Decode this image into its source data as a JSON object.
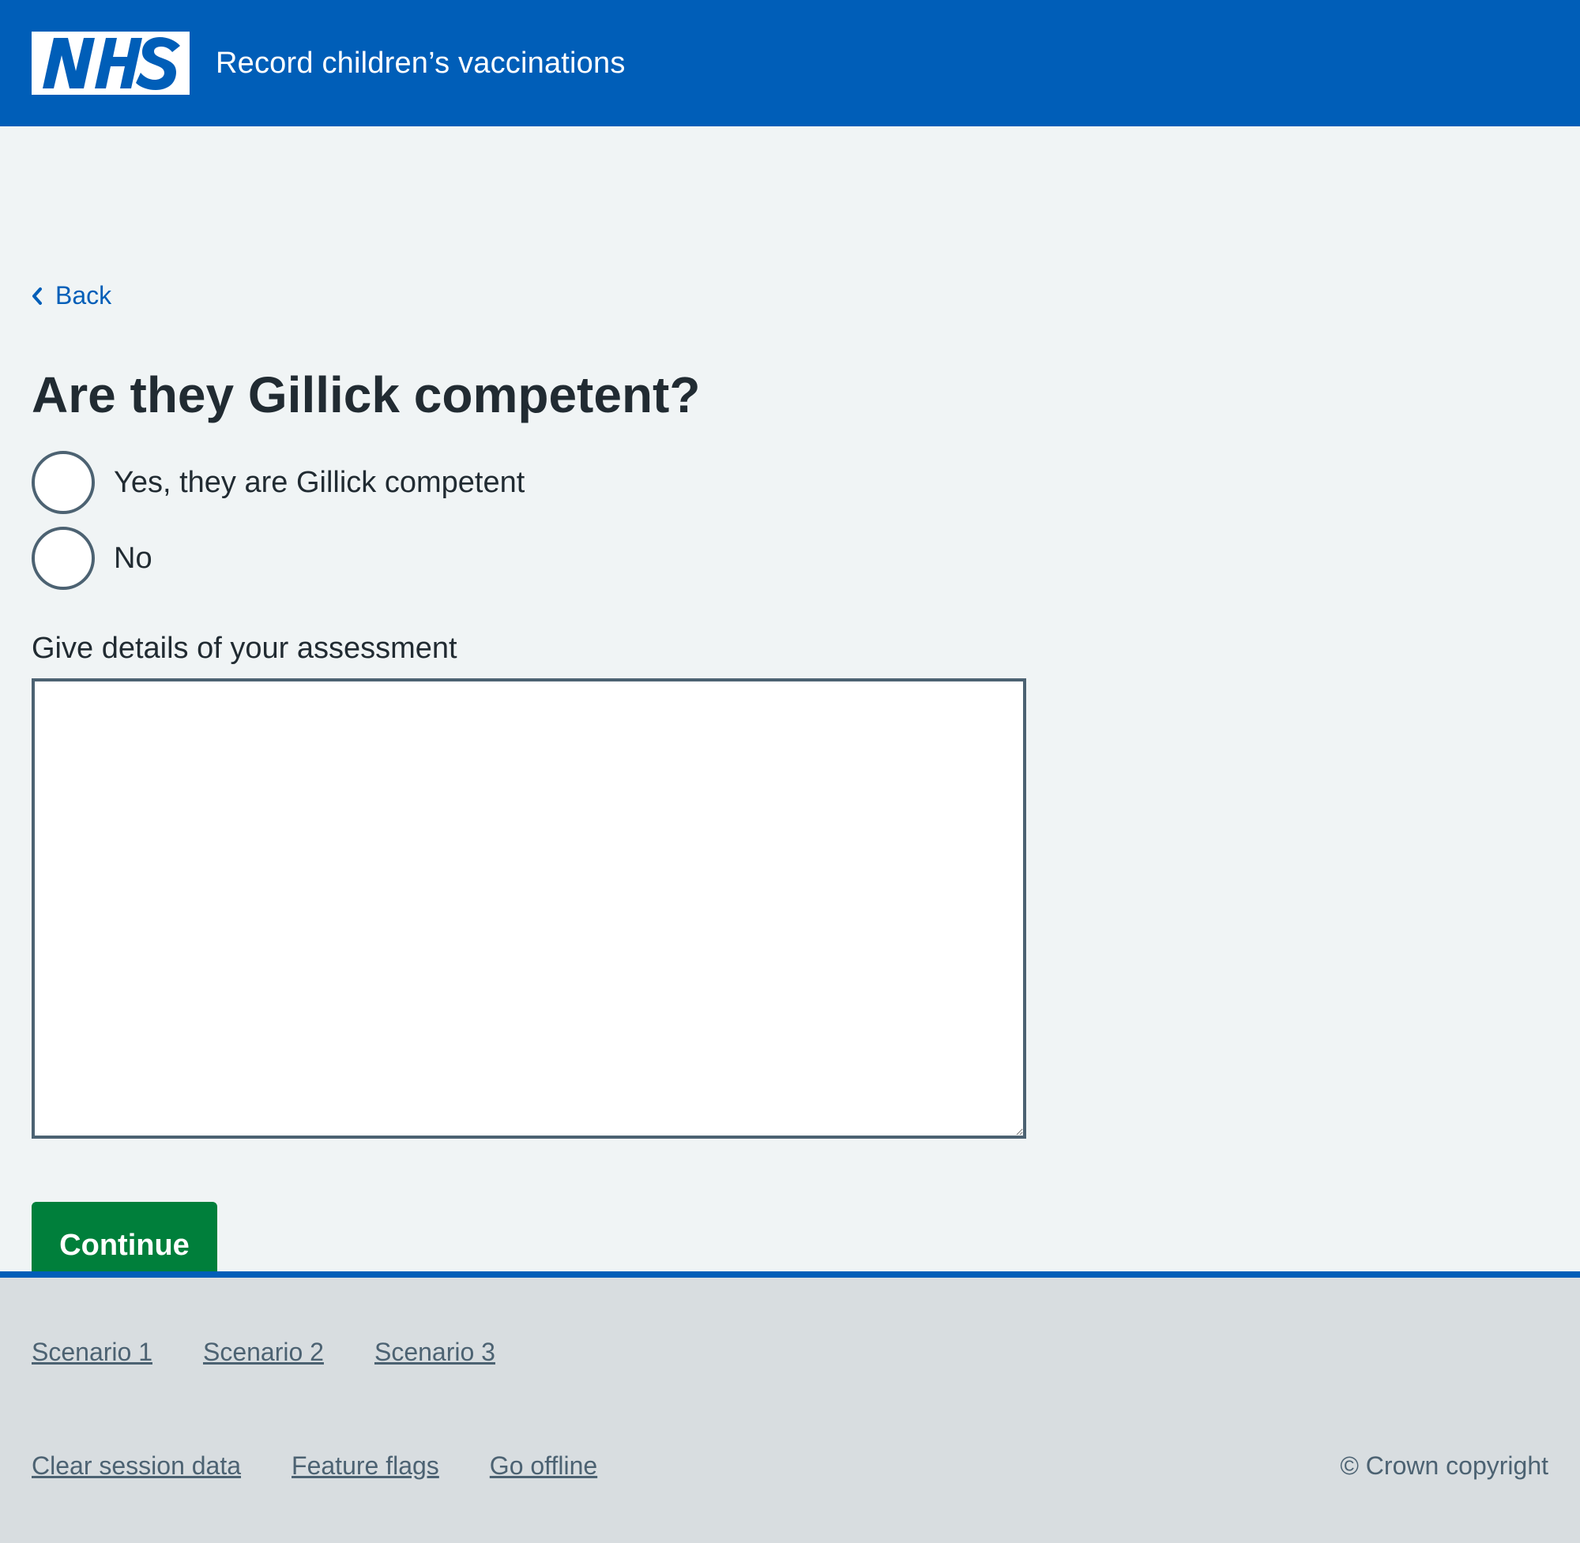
{
  "header": {
    "logo_text": "NHS",
    "service_name": "Record children’s vaccinations",
    "brand_color": "#005eb8"
  },
  "back_link": {
    "label": "Back",
    "icon": "chevron-left-icon"
  },
  "form": {
    "heading": "Are they Gillick competent?",
    "options": [
      {
        "label": "Yes, they are Gillick competent",
        "selected": false
      },
      {
        "label": "No",
        "selected": false
      }
    ],
    "details_label": "Give details of your assessment",
    "details_value": "",
    "continue_label": "Continue",
    "continue_color": "#007f3b"
  },
  "footer": {
    "scenario_links": [
      "Scenario 1",
      "Scenario 2",
      "Scenario 3"
    ],
    "utility_links": [
      "Clear session data",
      "Feature flags",
      "Go offline"
    ],
    "copyright": "© Crown copyright"
  }
}
